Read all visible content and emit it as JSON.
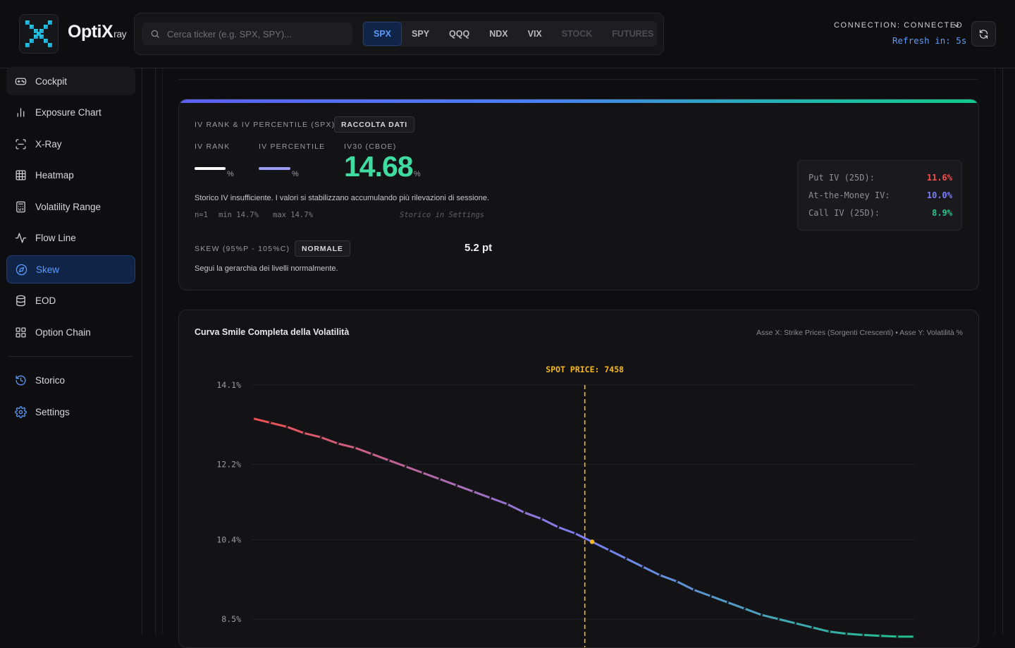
{
  "header": {
    "brand": "OptiX",
    "brand_sub": "ray",
    "search_placeholder": "Cerca ticker (e.g. SPX, SPY)...",
    "tickers": [
      {
        "label": "SPX",
        "state": "active"
      },
      {
        "label": "SPY",
        "state": "normal"
      },
      {
        "label": "QQQ",
        "state": "normal"
      },
      {
        "label": "NDX",
        "state": "normal"
      },
      {
        "label": "VIX",
        "state": "normal"
      },
      {
        "label": "STOCK",
        "state": "disabled"
      },
      {
        "label": "FUTURES",
        "state": "disabled"
      }
    ],
    "connection": "CONNECTION: CONNECTED",
    "refresh": "Refresh in: 5s"
  },
  "sidebar": {
    "items": [
      {
        "label": "Cockpit",
        "icon": "gamepad-icon"
      },
      {
        "label": "Exposure Chart",
        "icon": "bar-chart-icon"
      },
      {
        "label": "X-Ray",
        "icon": "scan-icon"
      },
      {
        "label": "Heatmap",
        "icon": "grid-icon"
      },
      {
        "label": "Volatility Range",
        "icon": "calculator-icon"
      },
      {
        "label": "Flow Line",
        "icon": "activity-icon"
      },
      {
        "label": "Skew",
        "icon": "compass-icon"
      },
      {
        "label": "EOD",
        "icon": "database-icon"
      },
      {
        "label": "Option Chain",
        "icon": "layout-grid-icon"
      }
    ],
    "bottom_items": [
      {
        "label": "Storico",
        "icon": "history-icon"
      },
      {
        "label": "Settings",
        "icon": "settings-icon"
      }
    ],
    "active": "Skew"
  },
  "iv_card": {
    "title": "IV RANK & IV PERCENTILE (SPX)",
    "badge": "RACCOLTA DATI",
    "iv_rank_label": "IV RANK",
    "iv_percentile_label": "IV PERCENTILE",
    "iv30_label": "IV30 (CBOE)",
    "iv_rank_value": "—",
    "iv_percentile_value": "—",
    "iv30_value": "14.68",
    "percent_sign": "%",
    "note": "Storico IV insufficiente. I valori si stabilizzano accumulando più rilevazioni di sessione.",
    "n": "n=1",
    "min": "min 14.7%",
    "max": "max 14.7%",
    "history_hint": "Storico in Settings",
    "skew_label": "SKEW (95%P - 105%C)",
    "skew_badge": "NORMALE",
    "skew_value": "5.2 pt",
    "skew_note": "Segui la gerarchia dei livelli normalmente.",
    "iv_list": [
      {
        "label": "Put IV (25D):",
        "value": "11.6%",
        "color": "#f0504f"
      },
      {
        "label": "At-the-Money IV:",
        "value": "10.0%",
        "color": "#7b7ef5"
      },
      {
        "label": "Call IV (25D):",
        "value": "8.9%",
        "color": "#25c78a"
      }
    ]
  },
  "chart_card": {
    "title": "Curva Smile Completa della Volatilità",
    "subtitle": "Asse X: Strike Prices (Sorgenti Crescenti) • Asse Y: Volatilità %"
  },
  "chart_data": {
    "type": "line",
    "title": "Curva Smile Completa della Volatilità",
    "xlabel": "",
    "ylabel": "",
    "y_ticks": [
      "14.1%",
      "12.2%",
      "10.4%",
      "8.5%"
    ],
    "y_tick_values": [
      14.1,
      12.2,
      10.4,
      8.5
    ],
    "spot_label": "SPOT PRICE: 7458",
    "spot_index": 20,
    "grid": true,
    "colors": {
      "start": "#f0504f",
      "mid": "#7b7ef5",
      "end": "#1fc08a",
      "spot": "#f5b71f"
    },
    "series": [
      {
        "values": [
          13.3,
          13.2,
          13.1,
          12.95,
          12.85,
          12.7,
          12.6,
          12.45,
          12.3,
          12.15,
          12.0,
          11.85,
          11.7,
          11.55,
          11.4,
          11.25,
          11.05,
          10.9,
          10.7,
          10.55,
          10.35,
          10.15,
          9.95,
          9.75,
          9.55,
          9.4,
          9.2,
          9.05,
          8.9,
          8.75,
          8.6,
          8.5,
          8.4,
          8.3,
          8.2,
          8.15,
          8.12,
          8.1,
          8.08,
          8.08
        ]
      }
    ]
  }
}
